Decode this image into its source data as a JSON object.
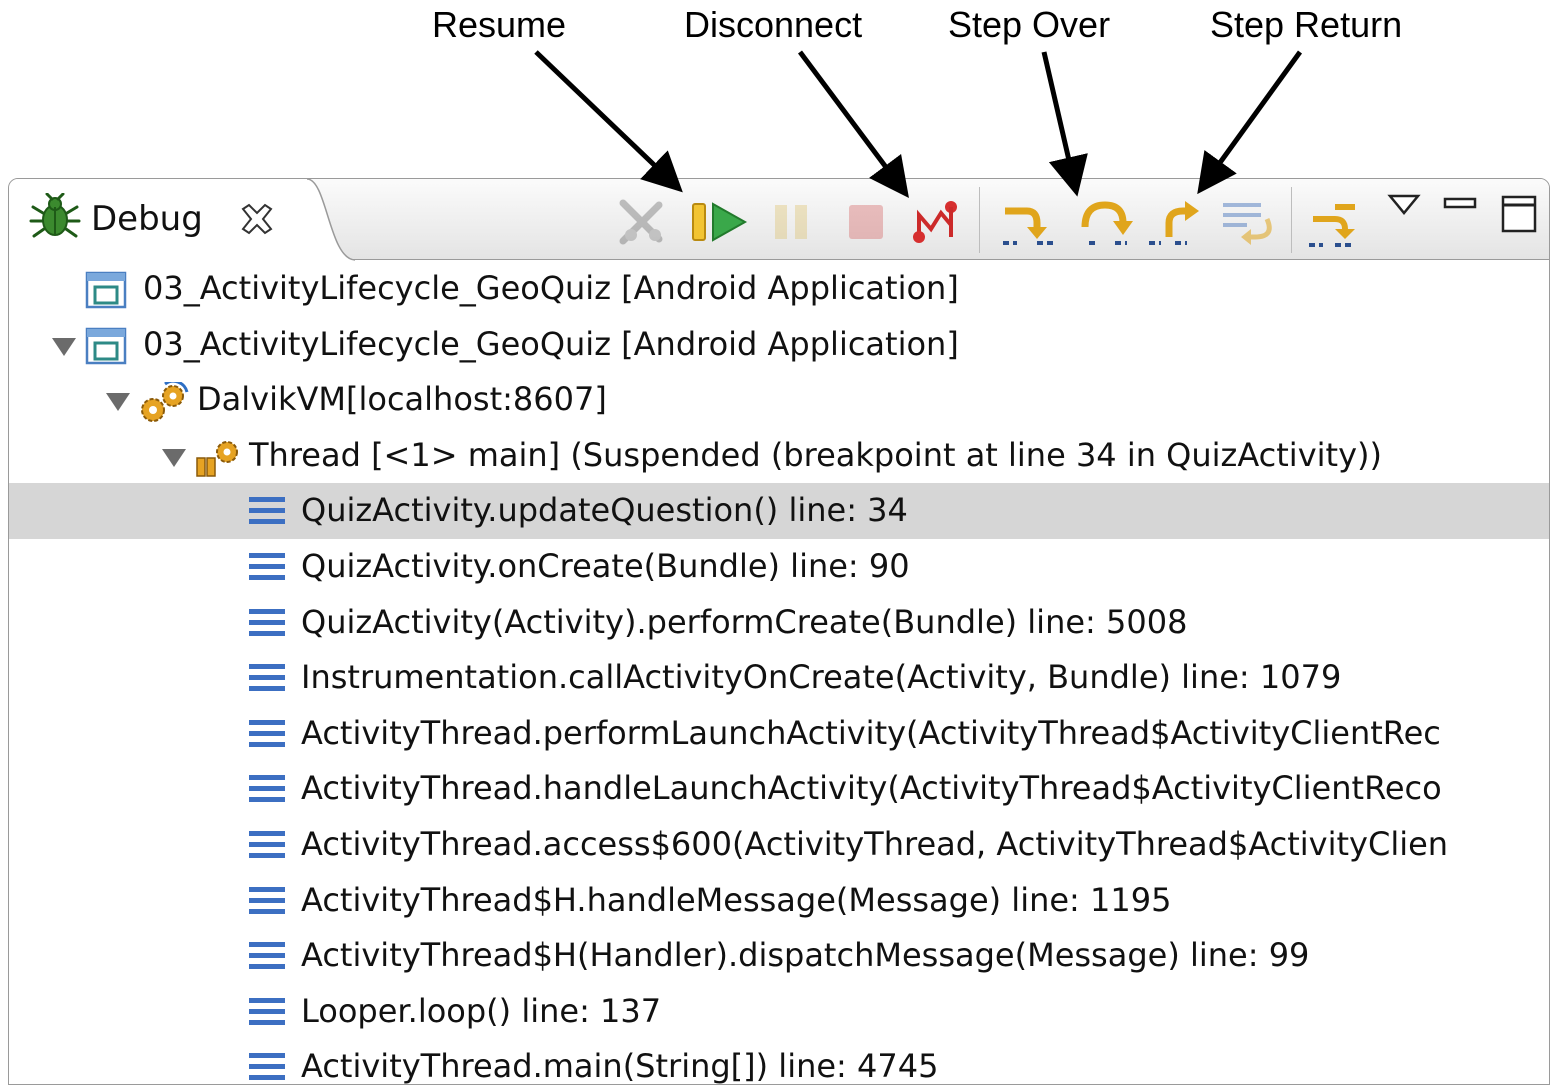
{
  "callouts": {
    "resume": "Resume",
    "disconnect": "Disconnect",
    "step_over": "Step Over",
    "step_return": "Step Return"
  },
  "view": {
    "tab_label": "Debug",
    "tab_icon": "bug-icon",
    "close_icon": "close-icon"
  },
  "toolbar": {
    "items": [
      {
        "name": "remove-terminated-icon",
        "enabled": false
      },
      {
        "name": "resume-icon",
        "enabled": true
      },
      {
        "name": "suspend-icon",
        "enabled": false
      },
      {
        "name": "terminate-icon",
        "enabled": false
      },
      {
        "name": "disconnect-icon",
        "enabled": true
      },
      {
        "name": "step-into-icon",
        "enabled": true
      },
      {
        "name": "step-over-icon",
        "enabled": true
      },
      {
        "name": "step-return-icon",
        "enabled": true
      },
      {
        "name": "drop-to-frame-icon",
        "enabled": false
      },
      {
        "name": "use-step-filters-icon",
        "enabled": true
      },
      {
        "name": "view-menu-icon",
        "enabled": true
      },
      {
        "name": "minimize-icon",
        "enabled": true
      },
      {
        "name": "maximize-icon",
        "enabled": true
      }
    ]
  },
  "tree": {
    "launch_1": "03_ActivityLifecycle_GeoQuiz [Android Application]",
    "launch_2": "03_ActivityLifecycle_GeoQuiz [Android Application]",
    "vm": "DalvikVM[localhost:8607]",
    "thread": "Thread [<1> main] (Suspended (breakpoint at line 34 in QuizActivity))",
    "frames": [
      "QuizActivity.updateQuestion() line: 34",
      "QuizActivity.onCreate(Bundle) line: 90",
      "QuizActivity(Activity).performCreate(Bundle) line: 5008",
      "Instrumentation.callActivityOnCreate(Activity, Bundle) line: 1079",
      "ActivityThread.performLaunchActivity(ActivityThread$ActivityClientRec",
      "ActivityThread.handleLaunchActivity(ActivityThread$ActivityClientReco",
      "ActivityThread.access$600(ActivityThread, ActivityThread$ActivityClien",
      "ActivityThread$H.handleMessage(Message) line: 1195",
      "ActivityThread$H(Handler).dispatchMessage(Message) line: 99",
      "Looper.loop() line: 137",
      "ActivityThread.main(String[]) line: 4745"
    ],
    "selected_frame": "QuizActivity.updateQuestion() line: 34"
  }
}
